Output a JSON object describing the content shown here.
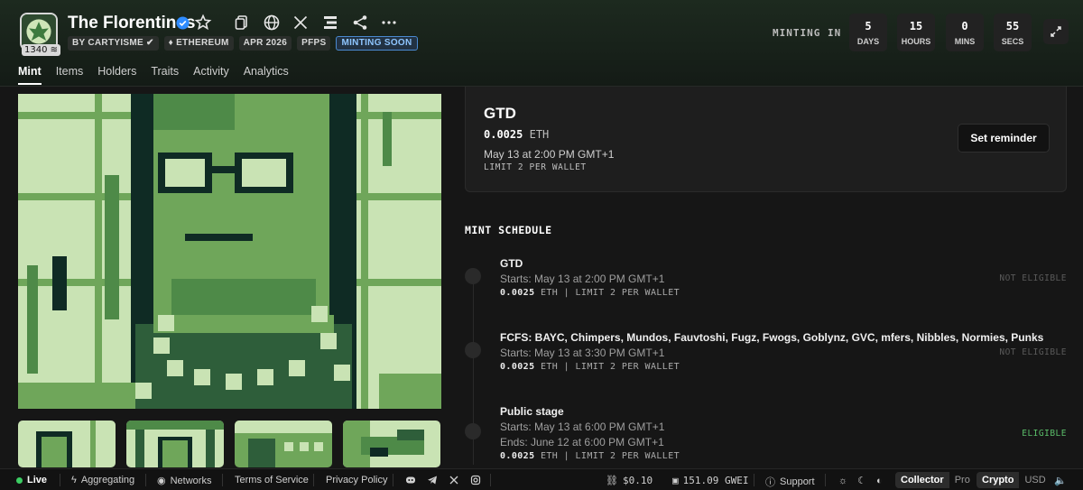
{
  "collection": {
    "title": "The Florentines",
    "logo_badge": "1340",
    "chips": [
      "BY CARTYISME",
      "ETHEREUM",
      "APR 2026",
      "PFPS",
      "MINTING SOON"
    ]
  },
  "countdown": {
    "label": "MINTING IN",
    "units": [
      {
        "value": "5",
        "label": "DAYS"
      },
      {
        "value": "15",
        "label": "HOURS"
      },
      {
        "value": "0",
        "label": "MINS"
      },
      {
        "value": "55",
        "label": "SECS"
      }
    ]
  },
  "header_icons": [
    "star-icon",
    "copy-icon",
    "globe-icon",
    "x-icon",
    "stack-icon",
    "share-icon",
    "more-icon"
  ],
  "tabs": [
    "Mint",
    "Items",
    "Holders",
    "Traits",
    "Activity",
    "Analytics"
  ],
  "active_tab": "Mint",
  "stage_card": {
    "title": "GTD",
    "price": "0.0025",
    "unit": "ETH",
    "date": "May 13 at 2:00 PM GMT+1",
    "limit": "LIMIT 2 PER WALLET",
    "button": "Set reminder"
  },
  "schedule": {
    "title": "MINT SCHEDULE",
    "rows": [
      {
        "title": "GTD",
        "starts": "Starts: May 13 at 2:00 PM GMT+1",
        "ends": "",
        "price": "0.0025",
        "meta": "ETH | LIMIT 2 PER WALLET",
        "eligibility": "NOT ELIGIBLE"
      },
      {
        "title": "FCFS: BAYC, Chimpers, Mundos, Fauvtoshi, Fugz, Fwogs, Goblynz, GVC, mfers, Nibbles, Normies, Punks",
        "starts": "Starts: May 13 at 3:30 PM GMT+1",
        "ends": "",
        "price": "0.0025",
        "meta": "ETH | LIMIT 2 PER WALLET",
        "eligibility": "NOT ELIGIBLE"
      },
      {
        "title": "Public stage",
        "starts": "Starts: May 13 at 6:00 PM GMT+1",
        "ends": "Ends: June 12 at 6:00 PM GMT+1",
        "price": "0.0025",
        "meta": "ETH | LIMIT 2 PER WALLET",
        "eligibility": "ELIGIBLE"
      }
    ]
  },
  "footer": {
    "live": "Live",
    "aggregating": "Aggregating",
    "networks": "Networks",
    "terms": "Terms of Service",
    "privacy": "Privacy Policy",
    "eth_price": "$0.10",
    "gas": "151.09 GWEI",
    "support": "Support",
    "mode": {
      "on": "Collector",
      "off": "Pro"
    },
    "currency": {
      "on": "Crypto",
      "off": "USD"
    }
  },
  "colors": {
    "accent_green": "#5bbf6a",
    "minting_chip": "#8fc6ff",
    "pixel_light": "#c9e3b4",
    "pixel_mid": "#6fa65a",
    "pixel_dark": "#0f2b24"
  }
}
